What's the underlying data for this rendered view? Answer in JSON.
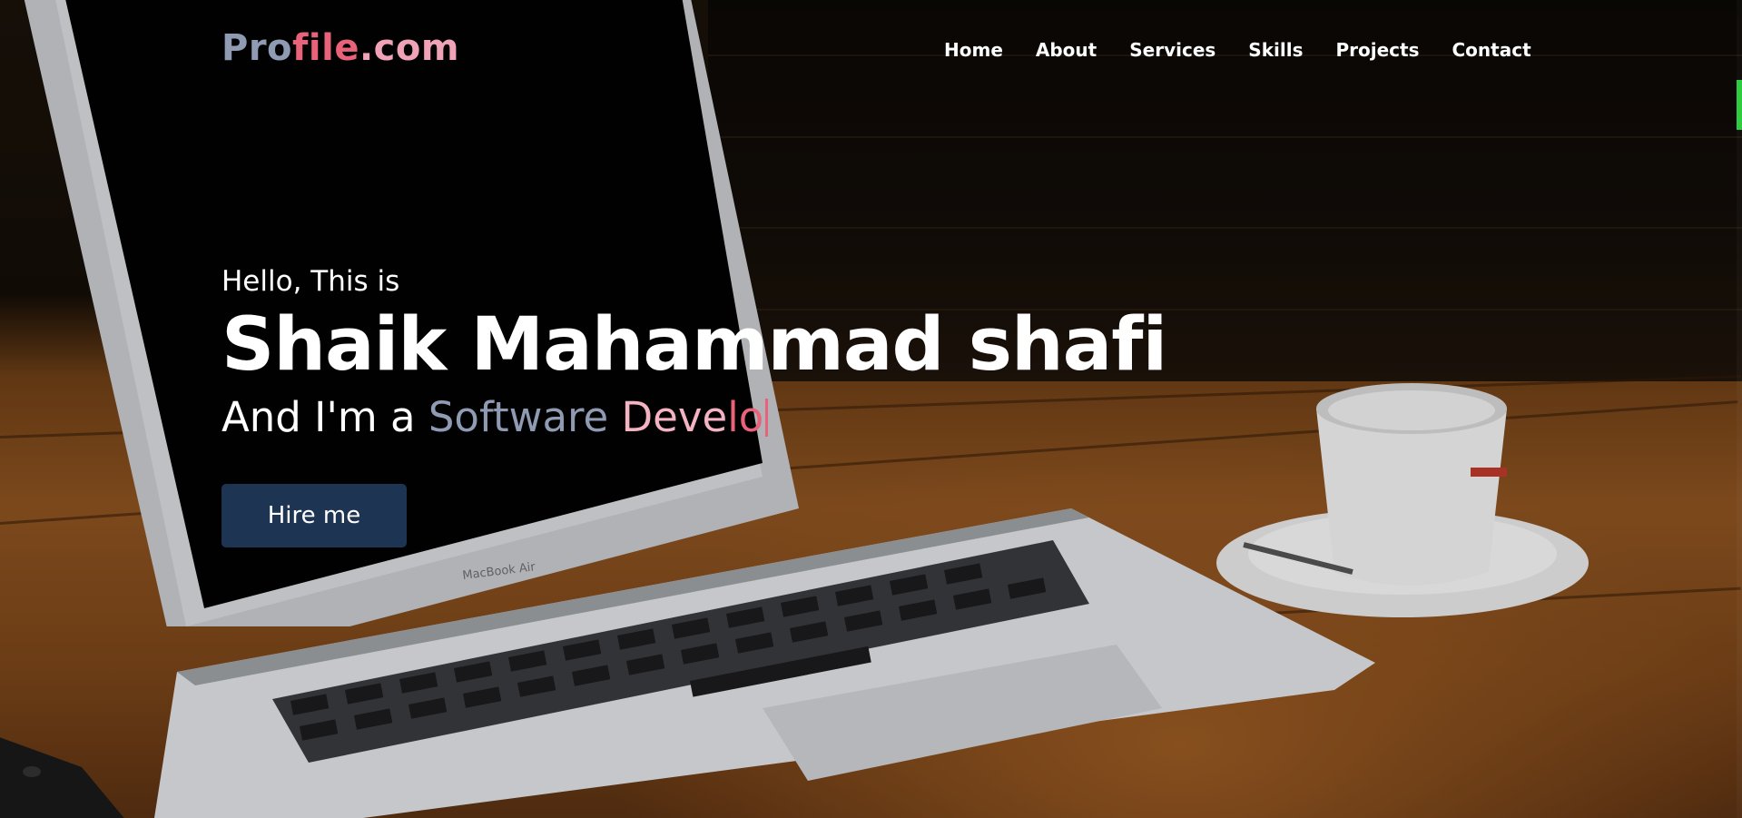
{
  "site": {
    "logo_part1": "Pro",
    "logo_part2": "file",
    "logo_part3": ".com"
  },
  "nav": {
    "items": [
      {
        "label": "Home"
      },
      {
        "label": "About"
      },
      {
        "label": "Services"
      },
      {
        "label": "Skills"
      },
      {
        "label": "Projects"
      },
      {
        "label": "Contact"
      }
    ]
  },
  "hero": {
    "greeting": "Hello, This is",
    "name": "Shaik Mahammad shafi",
    "tagline_prefix": "And I'm a ",
    "typed_part1": "Software",
    "typed_space": " ",
    "typed_part2": "Deve",
    "typed_part3": "lo",
    "hire_button": "Hire me"
  },
  "colors": {
    "accent_pink": "#e8637a",
    "accent_light_pink": "#f3b3c3",
    "accent_slate": "#8f9bb3",
    "button_bg": "#1d3452",
    "scroll_indicator": "#2ecc40"
  },
  "background_image": {
    "icons": [
      "laptop-image",
      "coffee-cup-image",
      "phone-image"
    ]
  }
}
